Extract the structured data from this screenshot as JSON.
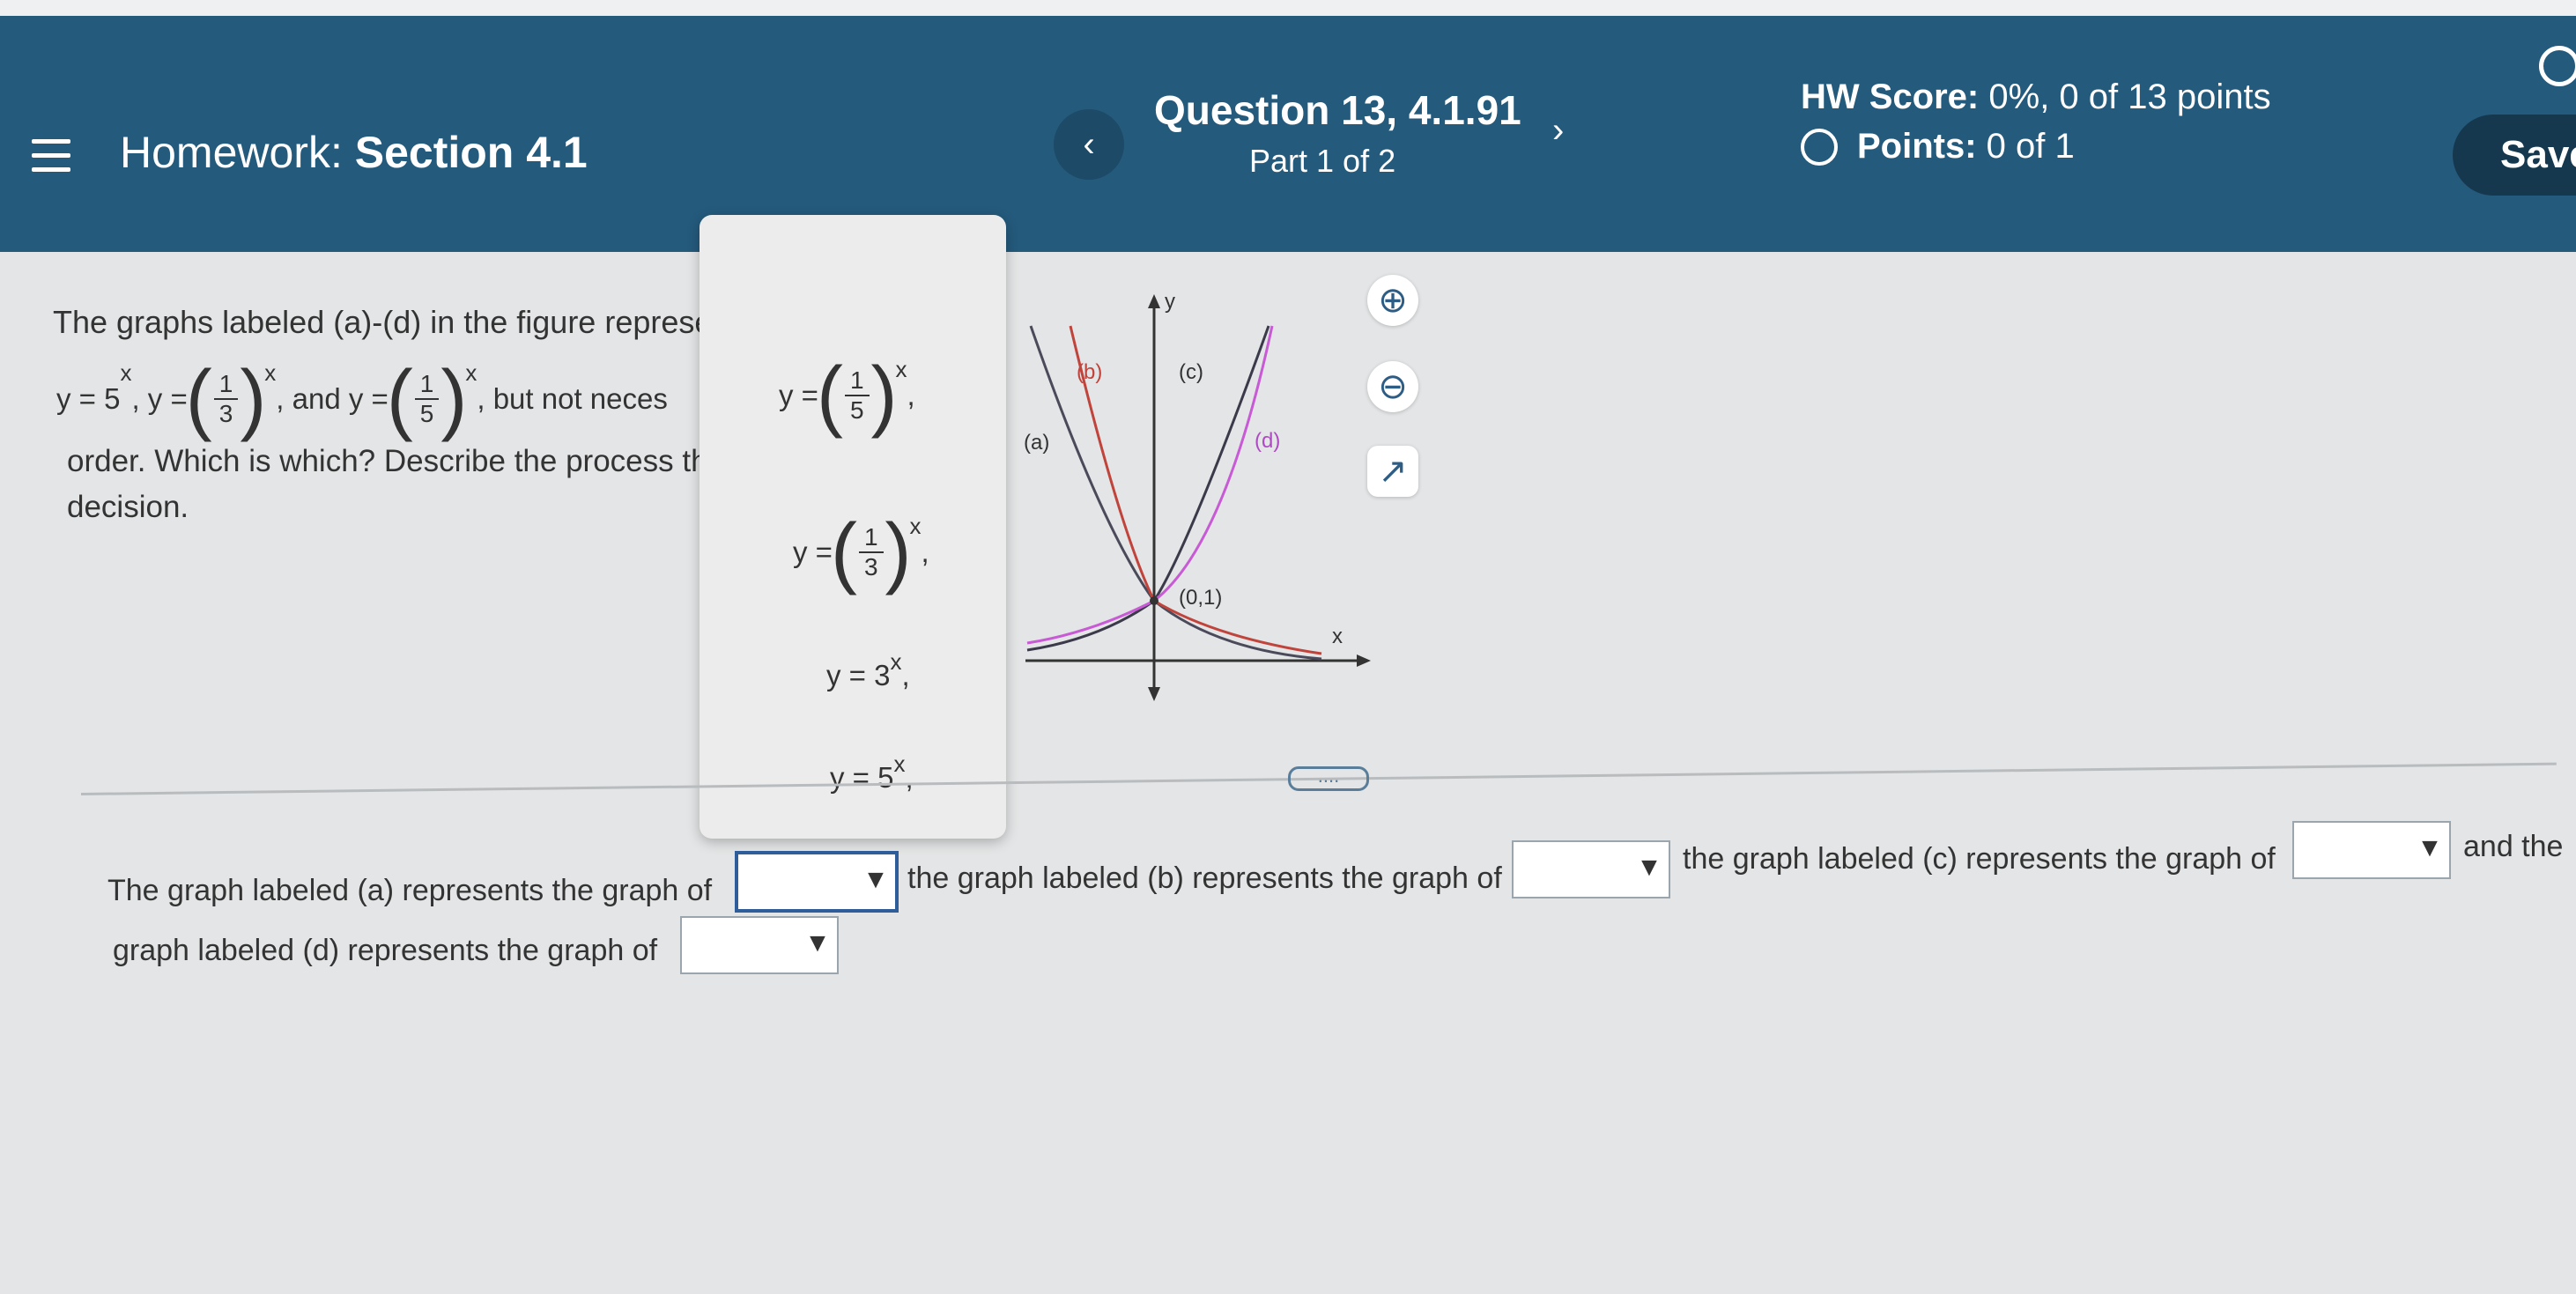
{
  "header": {
    "homework_prefix": "Homework:",
    "homework_section": "Section 4.1",
    "question_title": "Question 13, 4.1.91",
    "question_part": "Part 1 of 2",
    "hw_score_label": "HW Score:",
    "hw_score_value": "0%, 0 of 13 points",
    "points_label": "Points:",
    "points_value": "0 of 1",
    "save_label": "Save",
    "prev_glyph": "‹",
    "next_glyph": "›"
  },
  "question": {
    "line1": "The graphs labeled (a)-(d) in the figure represe",
    "line2_a": "y = 5",
    "line2_b": ", y =",
    "line2_c": ", and y =",
    "line2_d": ", but not neces",
    "line3": "order. Which is which? Describe the process th",
    "line4": "decision."
  },
  "popup_options": [
    {
      "prefix": "y =",
      "num": "1",
      "den": "5",
      "sup": "x",
      "suffix": ","
    },
    {
      "prefix": "y =",
      "num": "1",
      "den": "3",
      "sup": "x",
      "suffix": ","
    },
    {
      "prefix": "y = 3",
      "sup": "x",
      "suffix": ","
    },
    {
      "prefix": "y = 5",
      "sup": "x",
      "suffix": ","
    }
  ],
  "graph": {
    "y_axis_label": "y",
    "x_axis_label": "x",
    "label_a": "(a)",
    "label_b": "(b)",
    "label_c": "(c)",
    "label_d": "(d)",
    "point_label": "(0,1)",
    "colors": {
      "a": "#4a4a5a",
      "b": "#c0443c",
      "c": "#3a3a4a",
      "d": "#c85ad6"
    }
  },
  "answers": {
    "a_text": "The graph labeled (a) represents the graph of",
    "b_text": "the graph labeled (b) represents the graph of",
    "c_text": "the graph labeled (c) represents the graph of",
    "end_text": "and the",
    "d_text": "graph labeled (d) represents the graph of",
    "dropdown_arrow": "▼"
  },
  "more_dots": "....",
  "icons": {
    "zoom_in": "⊕",
    "zoom_out": "⊖",
    "popout": "↗"
  }
}
